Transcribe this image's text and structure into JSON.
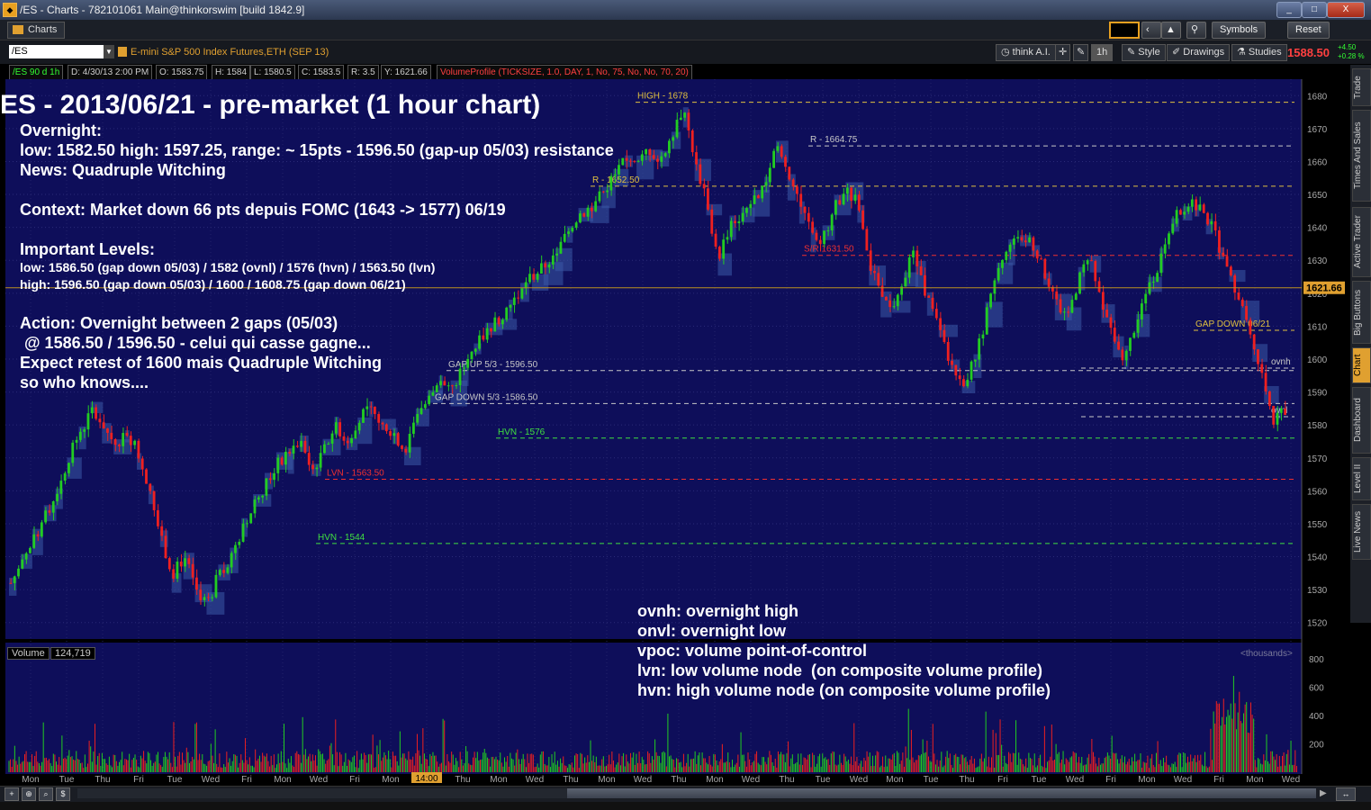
{
  "window": {
    "title": "/ES - Charts - 782101061 Main@thinkorswim [build 1842.9]",
    "controls": [
      "_",
      "□",
      "X"
    ]
  },
  "toolbar": {
    "tab_label": "Charts",
    "symbols_label": "Symbols",
    "reset_label": "Reset"
  },
  "symbol_bar": {
    "symbol": "/ES",
    "description": "E-mini S&P 500 Index Futures,ETH (SEP 13)",
    "think_ai": "think A.I.",
    "timeframe": "1h",
    "style_label": "Style",
    "drawings_label": "Drawings",
    "studies_label": "Studies",
    "last_price": "1588.50",
    "change": "+4.50",
    "change_pct": "+0.28 %"
  },
  "info_row": {
    "chart_id": "/ES 90 d 1h",
    "date": "D: 4/30/13 2:00 PM",
    "open": "O: 1583.75",
    "high": "H: 1584",
    "low": "L: 1580.5",
    "close": "C: 1583.5",
    "range": "R: 3.5",
    "y": "Y: 1621.66",
    "study": "VolumeProfile (TICKSIZE, 1.0, DAY, 1, No, 75, No, No, 70, 20)"
  },
  "right_tabs": [
    "Trade",
    "Times And Sales",
    "Active Trader",
    "Big Buttons",
    "Chart",
    "Dashboard",
    "Level II",
    "Live News"
  ],
  "active_right_tab": "Chart",
  "annotation": {
    "title": "ES - 2013/06/21 - pre-market (1 hour chart)",
    "overnight_heading": "Overnight:",
    "overnight_line": "low: 1582.50 high: 1597.25, range: ~ 15pts - 1596.50 (gap-up 05/03) resistance",
    "news_line": "News: Quadruple Witching",
    "context_line": "Context: Market down 66 pts depuis FOMC (1643 -> 1577) 06/19",
    "levels_heading": "Important Levels:",
    "low_levels": "low:  1586.50 (gap down 05/03) / 1582 (ovnl) / 1576 (hvn) / 1563.50 (lvn)",
    "high_levels": "high: 1596.50 (gap down 05/03) / 1600 / 1608.75 (gap down 06/21)",
    "action_1": "Action: Overnight between 2 gaps (05/03)",
    "action_2": " @ 1586.50 / 1596.50 - celui qui casse gagne...",
    "action_3": "Expect retest of 1600 mais Quadruple Witching",
    "action_4": "so who knows...."
  },
  "legend": {
    "ovnh": "ovnh: overnight high",
    "onvl": "onvl: overnight low",
    "vpoc": "vpoc: volume point-of-control",
    "lvn": "lvn: low volume node  (on composite volume profile)",
    "hvn": "hvn: high volume node (on composite volume profile)"
  },
  "volume_pane": {
    "label": "Volume",
    "value": "124,719",
    "units": "<thousands>",
    "ticks": [
      "800",
      "600",
      "400",
      "200"
    ]
  },
  "colors": {
    "background": "#0e0e5a",
    "up_candle": "#22cc22",
    "down_candle": "#ee2020",
    "profile": "#3a5aa8",
    "accent": "#e0a030"
  },
  "chart_data": {
    "type": "candlestick",
    "title": "",
    "ylim": [
      1515,
      1685
    ],
    "y_ticks": [
      1680,
      1670,
      1660,
      1650,
      1640,
      1630,
      1620,
      1610,
      1600,
      1590,
      1580,
      1570,
      1560,
      1550,
      1540,
      1530,
      1520
    ],
    "x_labels": [
      "Mon",
      "Tue",
      "Thu",
      "Fri",
      "Tue",
      "Wed",
      "Fri",
      "Mon",
      "Wed",
      "Fri",
      "Mon",
      "14:00",
      "Thu",
      "Mon",
      "Wed",
      "Thu",
      "Mon",
      "Wed",
      "Thu",
      "Mon",
      "Wed",
      "Thu",
      "Tue",
      "Wed",
      "Mon",
      "Tue",
      "Thu",
      "Fri",
      "Tue",
      "Wed",
      "Fri",
      "Mon",
      "Wed",
      "Fri",
      "Mon",
      "Wed"
    ],
    "current_price_label": "1621.66",
    "levels": [
      {
        "label": "HIGH - 1678",
        "value": 1678,
        "color": "#e0c040"
      },
      {
        "label": "R - 1664.75",
        "value": 1664.75,
        "color": "#c8c8c8"
      },
      {
        "label": "R - 1652.50",
        "value": 1652.5,
        "color": "#e0c040"
      },
      {
        "label": "S/R 1631.50",
        "value": 1631.5,
        "color": "#ee3030"
      },
      {
        "label": "GAP DOWN 06/21",
        "value": 1608.75,
        "color": "#e0c040"
      },
      {
        "label": "ovnh",
        "value": 1597.25,
        "color": "#c8c8c8"
      },
      {
        "label": "GAP UP 5/3 - 1596.50",
        "value": 1596.5,
        "color": "#c8c8c8"
      },
      {
        "label": "GAP DOWN 5/3 -1586.50",
        "value": 1586.5,
        "color": "#c8c8c8"
      },
      {
        "label": "ovnl",
        "value": 1582.5,
        "color": "#c8c8c8"
      },
      {
        "label": "HVN - 1576",
        "value": 1576,
        "color": "#40e040"
      },
      {
        "label": "LVN - 1563.50",
        "value": 1563.5,
        "color": "#ee3030"
      },
      {
        "label": "HVN - 1544",
        "value": 1544,
        "color": "#40e040"
      }
    ],
    "close_path": [
      1532,
      1538,
      1545,
      1552,
      1560,
      1570,
      1578,
      1584,
      1580,
      1574,
      1578,
      1572,
      1560,
      1545,
      1535,
      1540,
      1530,
      1526,
      1535,
      1540,
      1548,
      1556,
      1562,
      1568,
      1572,
      1575,
      1566,
      1572,
      1580,
      1575,
      1582,
      1585,
      1580,
      1578,
      1572,
      1584,
      1587,
      1594,
      1590,
      1597,
      1603,
      1608,
      1612,
      1616,
      1620,
      1625,
      1628,
      1632,
      1638,
      1644,
      1646,
      1650,
      1655,
      1660,
      1658,
      1664,
      1660,
      1668,
      1676,
      1662,
      1648,
      1630,
      1640,
      1644,
      1648,
      1652,
      1665,
      1658,
      1648,
      1640,
      1635,
      1645,
      1652,
      1648,
      1630,
      1620,
      1615,
      1625,
      1632,
      1620,
      1610,
      1600,
      1592,
      1598,
      1610,
      1625,
      1632,
      1638,
      1636,
      1628,
      1620,
      1612,
      1622,
      1632,
      1618,
      1608,
      1598,
      1610,
      1620,
      1628,
      1640,
      1646,
      1648,
      1644,
      1638,
      1626,
      1620,
      1608,
      1595,
      1582,
      1583.5
    ]
  }
}
